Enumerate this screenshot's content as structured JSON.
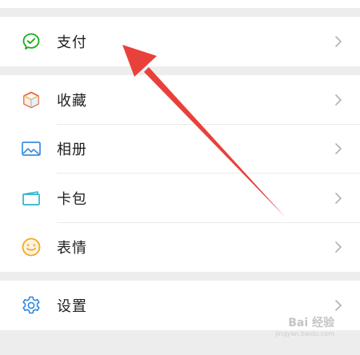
{
  "menu": {
    "groups": [
      {
        "items": [
          {
            "label": "支付",
            "icon": "wechat-pay-icon"
          }
        ]
      },
      {
        "items": [
          {
            "label": "收藏",
            "icon": "favorites-cube-icon"
          },
          {
            "label": "相册",
            "icon": "album-picture-icon"
          },
          {
            "label": "卡包",
            "icon": "card-wallet-icon"
          },
          {
            "label": "表情",
            "icon": "smiley-face-icon"
          }
        ]
      },
      {
        "items": [
          {
            "label": "设置",
            "icon": "gear-icon"
          }
        ]
      }
    ]
  },
  "colors": {
    "pay_green": "#1aad19",
    "arrow_red": "#e8413b",
    "background": "#ededed",
    "album_blue": "#3a8de0",
    "smiley_yellow": "#f5a623",
    "gear_blue": "#2f87de"
  },
  "watermark": {
    "brand": "Bai 经验",
    "sub": "jingyan.baidu.com"
  }
}
